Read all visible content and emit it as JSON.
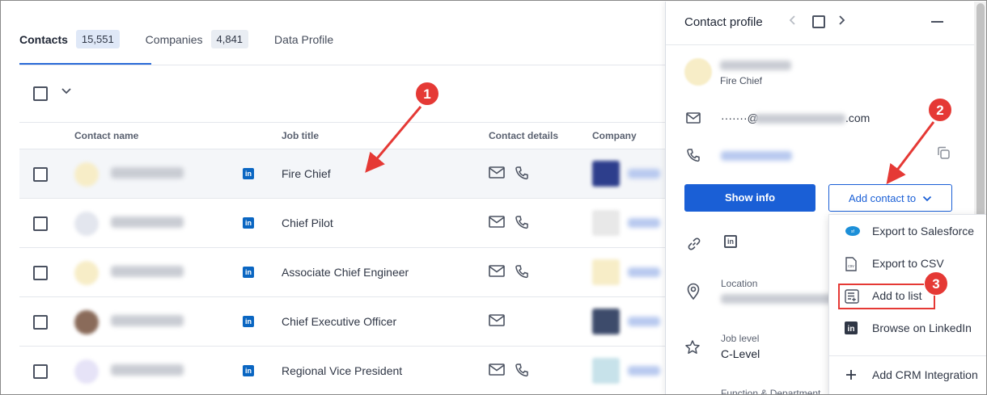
{
  "tabs": [
    {
      "label": "Contacts",
      "count": "15,551"
    },
    {
      "label": "Companies",
      "count": "4,841"
    },
    {
      "label": "Data Profile"
    }
  ],
  "table": {
    "columns": [
      "Contact name",
      "Job title",
      "Contact details",
      "Company"
    ],
    "rows": [
      {
        "job_title": "Fire Chief",
        "avatar_color": "#f7edc7",
        "logo_color": "#2d3e8c",
        "has_phone": true
      },
      {
        "job_title": "Chief Pilot",
        "avatar_color": "#e3e6ee",
        "logo_color": "#e8e8e8",
        "has_phone": true
      },
      {
        "job_title": "Associate Chief Engineer",
        "avatar_color": "#f7edc7",
        "logo_color": "#f7edc7",
        "has_phone": true
      },
      {
        "job_title": "Chief Executive Officer",
        "avatar_color": "#8a6b5a",
        "logo_color": "#3d4b6b",
        "has_phone": false
      },
      {
        "job_title": "Regional Vice President",
        "avatar_color": "#e6e3f7",
        "logo_color": "#c7e2ea",
        "has_phone": true
      }
    ]
  },
  "panel": {
    "title": "Contact profile",
    "role": "Fire Chief",
    "email_prefix": "·······@",
    "email_suffix": ".com",
    "show_info_label": "Show info",
    "add_contact_label": "Add contact to",
    "location_label": "Location",
    "job_level_label": "Job level",
    "job_level_value": "C-Level",
    "function_label": "Function & Department"
  },
  "menu": {
    "items": [
      {
        "label": "Export to Salesforce",
        "icon": "salesforce-icon"
      },
      {
        "label": "Export to CSV",
        "icon": "csv-icon"
      },
      {
        "label": "Add to list",
        "icon": "add-list-icon"
      },
      {
        "label": "Browse on LinkedIn",
        "icon": "linkedin-icon"
      },
      {
        "label": "Add CRM Integration",
        "icon": "plus-icon"
      }
    ]
  },
  "annotations": {
    "markers": [
      "1",
      "2",
      "3"
    ],
    "color": "#e53935"
  },
  "colors": {
    "accent": "#1a5fd6",
    "linkedin": "#0a66c2"
  }
}
